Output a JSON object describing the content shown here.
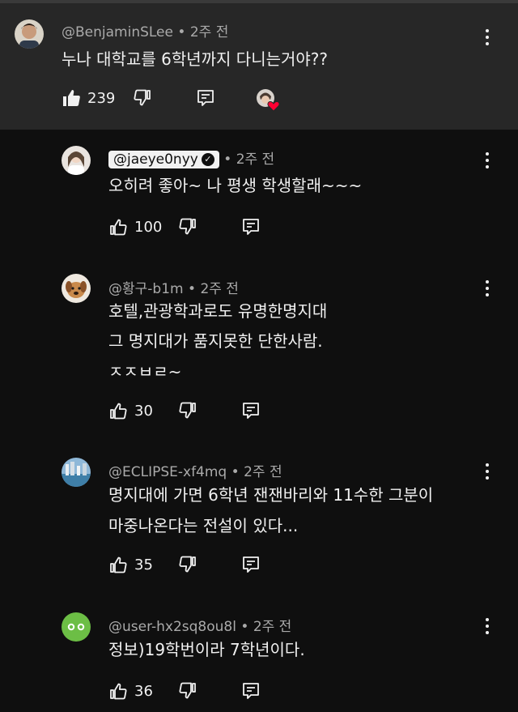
{
  "comments": [
    {
      "author": "@BenjaminSLee",
      "time": "2주 전",
      "text": [
        "누나 대학교를 6학년까지 다니는거야??"
      ],
      "likes": "239",
      "hearted": true
    },
    {
      "author": "@jaeye0nyy",
      "time": "2주 전",
      "text": [
        "오히려 좋아~ 나 평생 학생할래~~~"
      ],
      "likes": "100"
    },
    {
      "author": "@황구-b1m",
      "time": "2주 전",
      "text": [
        "호텔,관광학과로도 유명한명지대",
        "그 명지대가 품지못한 단한사람.",
        "ㅈㅈㅂㄹ~"
      ],
      "likes": "30"
    },
    {
      "author": "@ECLIPSE-xf4mq",
      "time": "2주 전",
      "text": [
        "명지대에 가면 6학년 잰잰바리와 11수한 그분이",
        "마중나온다는 전설이 있다..."
      ],
      "likes": "35"
    },
    {
      "author": "@user-hx2sq8ou8l",
      "time": "2주 전",
      "text": [
        "정보)19학번이라 7학년이다."
      ],
      "likes": "36"
    }
  ],
  "colors": {
    "background": "#0f0f0f",
    "highlight": "#272727",
    "text": "#f1f1f1",
    "meta": "#aaaaaa",
    "heart": "#ff0033",
    "avatar5": "#6cbe45"
  },
  "icons": [
    "like-icon",
    "dislike-icon",
    "reply-icon",
    "more-options-icon",
    "heart-icon",
    "verified-icon"
  ]
}
